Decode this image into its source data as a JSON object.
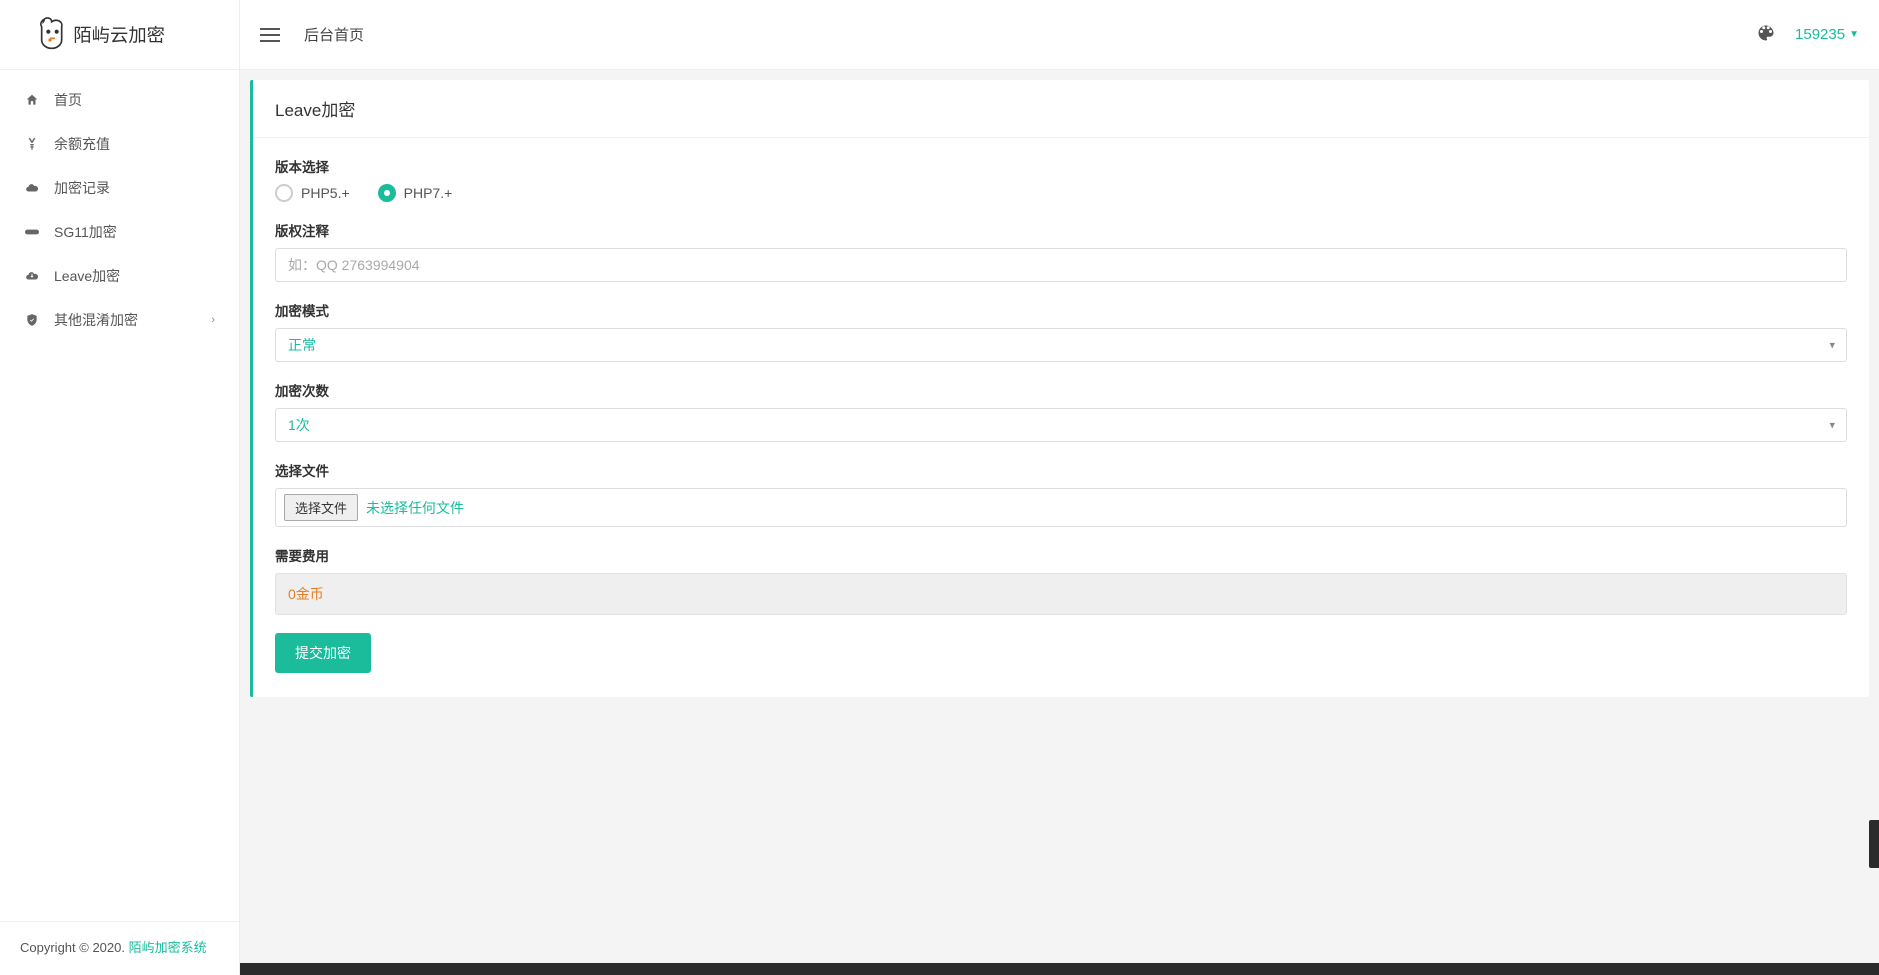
{
  "brand": {
    "name": "陌屿云加密"
  },
  "header": {
    "breadcrumb": "后台首页",
    "balance": "159235"
  },
  "sidebar": {
    "items": [
      {
        "label": "首页",
        "icon": "home"
      },
      {
        "label": "余额充值",
        "icon": "yen"
      },
      {
        "label": "加密记录",
        "icon": "cloud"
      },
      {
        "label": "SG11加密",
        "icon": "link"
      },
      {
        "label": "Leave加密",
        "icon": "cloud-download"
      },
      {
        "label": "其他混淆加密",
        "icon": "shield",
        "chevron": true
      }
    ]
  },
  "footer": {
    "prefix": "Copyright © 2020. ",
    "link": "陌屿加密系统"
  },
  "card": {
    "title": "Leave加密",
    "version": {
      "label": "版本选择",
      "options": [
        {
          "label": "PHP5.+",
          "checked": false
        },
        {
          "label": "PHP7.+",
          "checked": true
        }
      ]
    },
    "copyright": {
      "label": "版权注释",
      "placeholder": "如：QQ 2763994904"
    },
    "mode": {
      "label": "加密模式",
      "value": "正常"
    },
    "count": {
      "label": "加密次数",
      "value": "1次"
    },
    "file": {
      "label": "选择文件",
      "button": "选择文件",
      "status": "未选择任何文件"
    },
    "cost": {
      "label": "需要费用",
      "value": "0金币"
    },
    "submit": "提交加密"
  }
}
